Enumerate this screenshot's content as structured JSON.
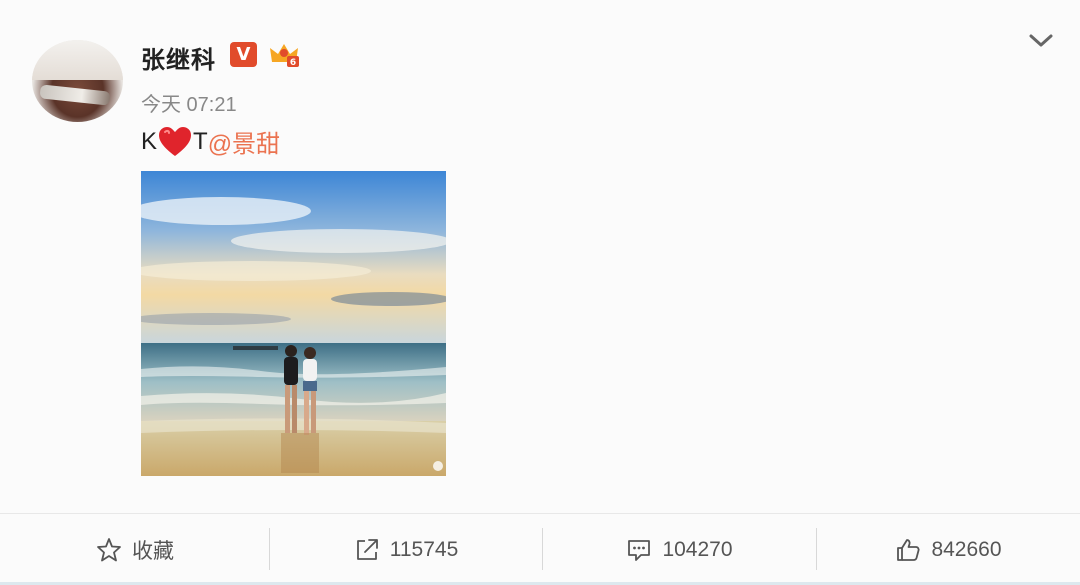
{
  "post": {
    "username": "张继科",
    "verified_badge": "V",
    "time": "今天 07:21",
    "text_prefix": "K",
    "text_middle": "T",
    "mention": "@景甜",
    "photo_icon": "beach-couple-photo"
  },
  "actions": {
    "favorite_label": "收藏",
    "repost_count": "115745",
    "comment_count": "104270",
    "like_count": "842660"
  },
  "colors": {
    "mention": "#eb7350",
    "verified": "#e14b2b",
    "heart": "#e0242c"
  }
}
